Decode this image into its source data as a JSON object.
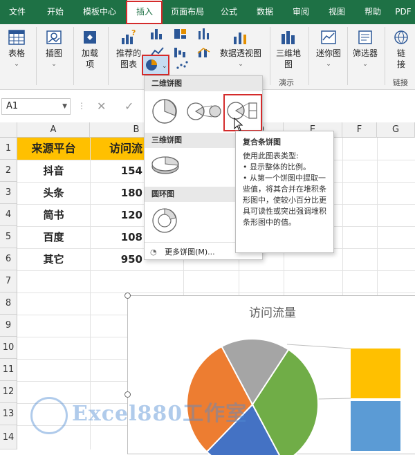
{
  "tabs": [
    {
      "label": "文件"
    },
    {
      "label": "开始"
    },
    {
      "label": "模板中心"
    },
    {
      "label": "插入"
    },
    {
      "label": "页面布局"
    },
    {
      "label": "公式"
    },
    {
      "label": "数据"
    },
    {
      "label": "审阅"
    },
    {
      "label": "视图"
    },
    {
      "label": "帮助"
    },
    {
      "label": "PDF"
    }
  ],
  "ribbon": {
    "table": "表格",
    "illustrations": "插图",
    "addins_1": "加载",
    "addins_2": "项",
    "recommended_1": "推荐的",
    "recommended_2": "图表",
    "pivot_chart": "数据透视图",
    "map3d_1": "三维地",
    "map3d_2": "图",
    "tours_group": "演示",
    "sparklines": "迷你图",
    "filters": "筛选器",
    "link_1": "链",
    "link_2": "接",
    "links_group": "链接"
  },
  "formula_bar": {
    "name_box": "A1"
  },
  "grid": {
    "columns": [
      "A",
      "B",
      "C",
      "D",
      "E",
      "F",
      "G"
    ],
    "rows": [
      "1",
      "2",
      "3",
      "4",
      "5",
      "6",
      "7",
      "8",
      "9",
      "10",
      "11",
      "12",
      "13",
      "14"
    ],
    "header_row": {
      "platform": "来源平台",
      "visits": "访问流"
    },
    "data": [
      {
        "platform": "抖音",
        "visits": "154"
      },
      {
        "platform": "头条",
        "visits": "180"
      },
      {
        "platform": "简书",
        "visits": "120"
      },
      {
        "platform": "百度",
        "visits": "108"
      },
      {
        "platform": "其它",
        "visits": "950"
      }
    ]
  },
  "dropdown": {
    "section_2d": "二维饼图",
    "section_3d": "三维饼图",
    "section_doughnut": "圆环图",
    "more": "更多饼图(M)..."
  },
  "tooltip": {
    "title": "复合条饼图",
    "line1": "使用此图表类型:",
    "line2": "• 显示整体的比例。",
    "line3": "• 从第一个饼图中提取一些值，将其合并在堆积条形图中，使较小百分比更具可读性或突出强调堆积条形图中的值。"
  },
  "chart_data": {
    "type": "pie",
    "title": "访问流量",
    "slices": [
      {
        "color": "#70ad47",
        "value": 33
      },
      {
        "color": "#4472c4",
        "value": 20
      },
      {
        "color": "#ed7d31",
        "value": 30
      },
      {
        "color": "#a5a5a5",
        "value": 17
      }
    ],
    "bar_segments": [
      {
        "color": "#ffc000"
      },
      {
        "color": "#5b9bd5"
      }
    ]
  },
  "watermark": "Excel880工作室",
  "colors": {
    "ribbon_green": "#1e7145",
    "header_fill": "#ffc000",
    "highlight_red": "#d42b2b"
  }
}
